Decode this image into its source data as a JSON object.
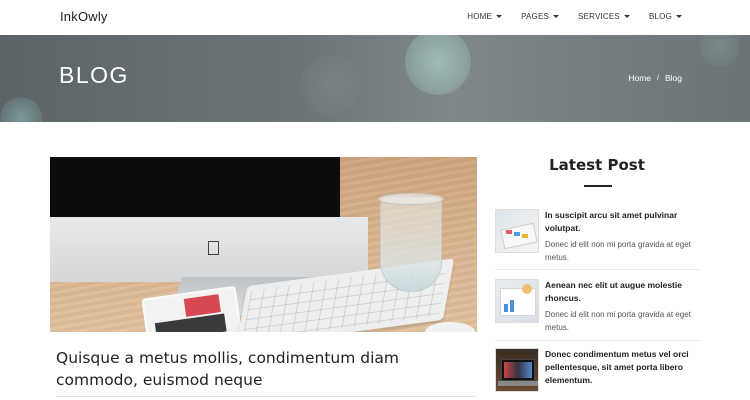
{
  "navbar": {
    "brand": "InkOwly",
    "menu": [
      {
        "label": "HOME"
      },
      {
        "label": "PAGES"
      },
      {
        "label": "SERVICES"
      },
      {
        "label": "BLOG"
      }
    ]
  },
  "hero": {
    "title": "BLOG",
    "breadcrumb": {
      "home": "Home",
      "separator": "/",
      "current": "Blog"
    }
  },
  "post": {
    "title": "Quisque a metus mollis, condimentum diam commodo, euismod neque"
  },
  "sidebar": {
    "title": "Latest Post",
    "items": [
      {
        "title": "In suscipit arcu sit amet pulvinar volutpat.",
        "text": "Donec id elit non mi porta gravida at eget metus."
      },
      {
        "title": "Aenean nec elit ut augue molestie rhoncus.",
        "text": "Donec id elit non mi porta gravida at eget metus."
      },
      {
        "title": "Donec condimentum metus vel orci pellentesque, sit amet porta libero elementum.",
        "text": ""
      }
    ]
  }
}
